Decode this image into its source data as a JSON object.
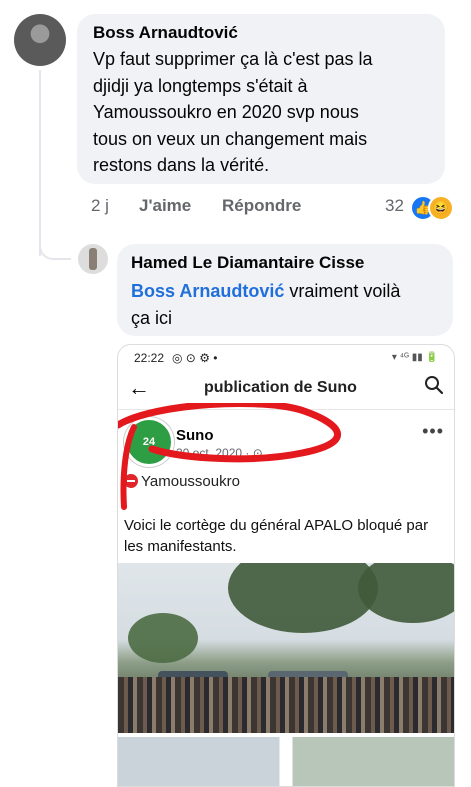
{
  "comment": {
    "author": "Boss Arnaudtović",
    "lines": [
      "Vp faut supprimer ça là c'est pas la",
      "djidji ya longtemps s'était à",
      "Yamoussoukro en 2020 svp nous",
      "tous on veux un changement mais",
      "restons dans la vérité."
    ],
    "time": "2 j",
    "like_label": "J'aime",
    "reply_label": "Répondre",
    "reaction_count": "32",
    "reaction_icons": [
      "like-icon",
      "haha-icon"
    ],
    "like_symbol": "👍",
    "haha_symbol": "😆"
  },
  "reply": {
    "author": "Hamed Le Diamantaire Cisse",
    "mention": "Boss Arnaudtović",
    "text_after_mention": " vraiment voilà",
    "line2": "ça ici"
  },
  "screenshot": {
    "status_time": "22:22",
    "status_icons": "◎ ⊙ ⚙ •",
    "status_right": "▾ ⁴ᴳ ▮▮ 🔋",
    "back_symbol": "←",
    "title": "publication de Suno",
    "page_logo_text": "24",
    "page_name": "Suno",
    "post_date": "30 oct. 2020 · ⊙",
    "more_symbol": "•••",
    "location": "Yamoussoukro",
    "post_text": "Voici le cortège  du général  APALO bloqué par les manifestants."
  },
  "colors": {
    "bubble": "#f0f2f5",
    "mention": "#216fdb",
    "meta_text": "#65676b",
    "scribble": "#e3191e"
  }
}
